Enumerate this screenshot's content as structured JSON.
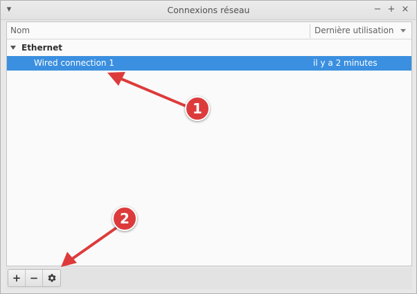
{
  "window": {
    "title": "Connexions réseau",
    "menu_glyph": "▾",
    "minimize_glyph": "−",
    "maximize_glyph": "+",
    "close_glyph": "×"
  },
  "columns": {
    "name": "Nom",
    "last_used": "Dernière utilisation"
  },
  "groups": [
    {
      "label": "Ethernet",
      "connections": [
        {
          "name": "Wired connection 1",
          "last_used": "il y a 2 minutes",
          "selected": true
        }
      ]
    }
  ],
  "toolbar": {
    "add_glyph": "+",
    "remove_glyph": "−",
    "settings_icon": "gear-icon"
  },
  "annotations": {
    "badge_1": "1",
    "badge_2": "2",
    "color": "#dd3b3b"
  },
  "colors": {
    "selection": "#3b8fe0"
  }
}
